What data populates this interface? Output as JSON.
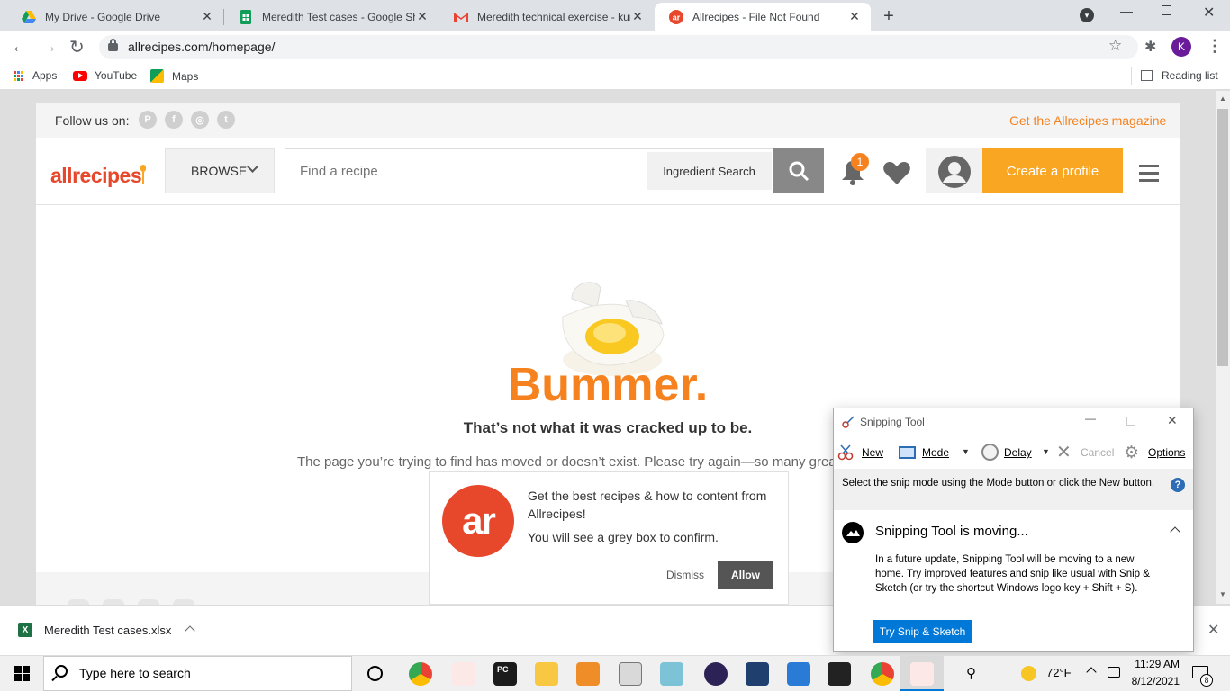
{
  "browser": {
    "tabs": [
      {
        "title": "My Drive - Google Drive",
        "close": "✕"
      },
      {
        "title": "Meredith Test cases - Google She",
        "close": "✕"
      },
      {
        "title": "Meredith technical exercise - kun",
        "close": "✕"
      },
      {
        "title": "Allrecipes - File Not Found",
        "close": "✕"
      }
    ],
    "new_tab": "+",
    "url": "allrecipes.com/homepage/",
    "profile_initial": "K",
    "bookmarks": [
      "Apps",
      "YouTube",
      "Maps"
    ],
    "reading_list": "Reading list"
  },
  "site": {
    "follow_label": "Follow us on:",
    "magazine_link": "Get the Allrecipes magazine",
    "logo": "allrecipes",
    "browse_label": "BROWSE",
    "search_placeholder": "Find a recipe",
    "ingredient_search": "Ingredient Search",
    "notification_count": "1",
    "create_profile": "Create a profile",
    "error_title": "Bummer.",
    "error_subtitle": "That’s not what it was cracked up to be.",
    "error_message": "The page you’re trying to find has moved or doesn’t exist. Please try again—so many great"
  },
  "popup": {
    "logo_text": "ar",
    "line1": "Get the best recipes & how to content from Allrecipes!",
    "line2": "You will see a grey box to confirm.",
    "dismiss": "Dismiss",
    "allow": "Allow"
  },
  "snipping": {
    "title": "Snipping Tool",
    "new": "New",
    "mode": "Mode",
    "delay": "Delay",
    "cancel": "Cancel",
    "options": "Options",
    "instructions": "Select the snip mode using the Mode button or click the New button.",
    "notice_title": "Snipping Tool is moving...",
    "notice_body": "In a future update, Snipping Tool will be moving to a new home. Try improved features and snip like usual with Snip & Sketch (or try the shortcut Windows logo key + Shift + S).",
    "try_button": "Try Snip & Sketch"
  },
  "download": {
    "filename": "Meredith Test cases.xlsx"
  },
  "taskbar": {
    "search_placeholder": "Type here to search",
    "weather": "72°F",
    "time": "11:29 AM",
    "date": "8/12/2021",
    "notification_count": "8"
  },
  "colors": {
    "brand_orange": "#f5821f",
    "create_profile_bg": "#f9a623",
    "allow_bg": "#555555",
    "snip_blue": "#0078d7"
  }
}
